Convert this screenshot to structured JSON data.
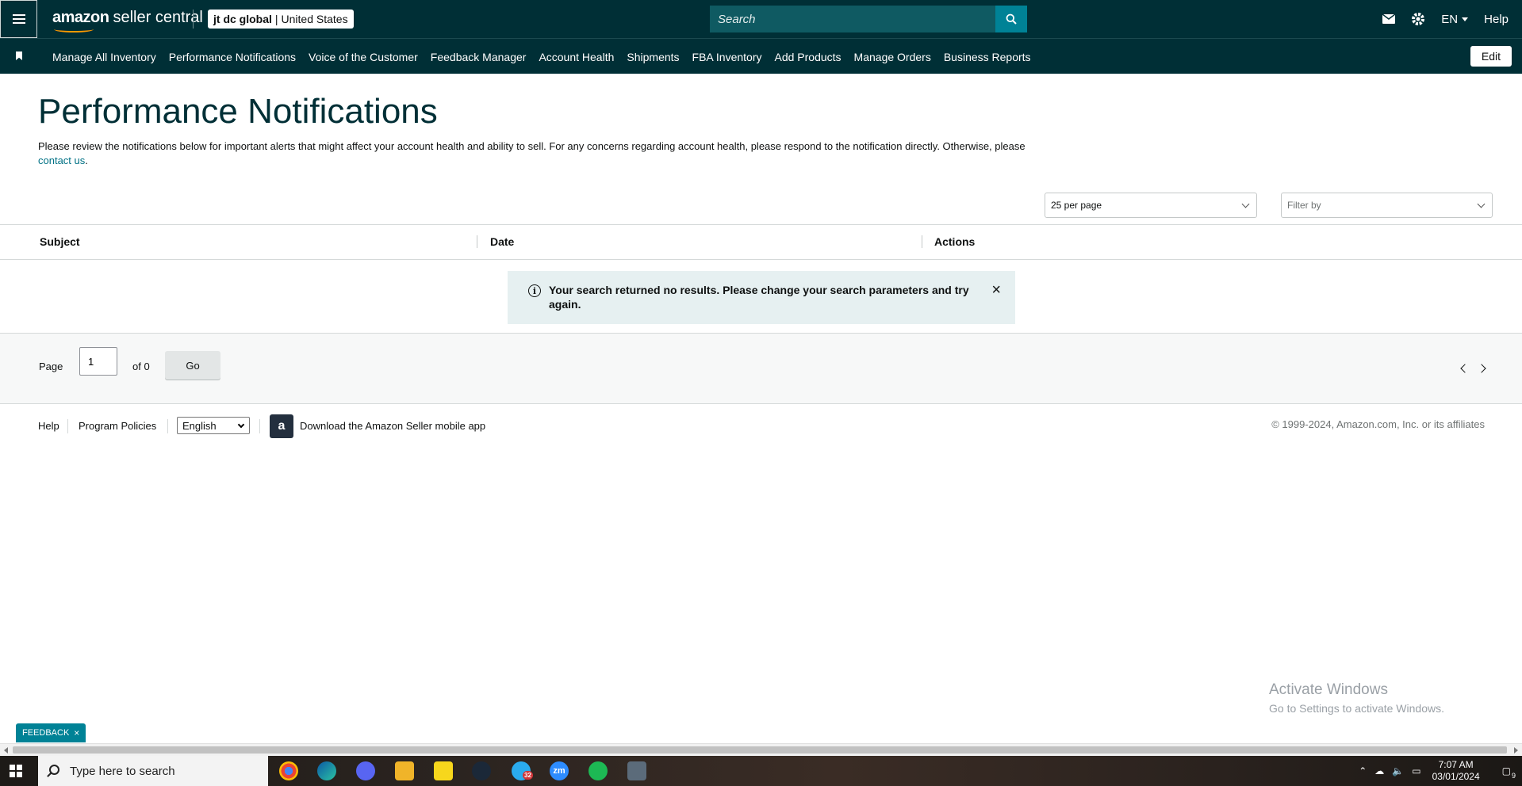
{
  "header": {
    "logo_brand": "amazon",
    "logo_product": "seller central",
    "account_name": "jt dc global",
    "account_separator": "|",
    "marketplace": "United States",
    "search_placeholder": "Search",
    "language": "EN",
    "help": "Help"
  },
  "nav": {
    "items": [
      "Manage All Inventory",
      "Performance Notifications",
      "Voice of the Customer",
      "Feedback Manager",
      "Account Health",
      "Shipments",
      "FBA Inventory",
      "Add Products",
      "Manage Orders",
      "Business Reports"
    ],
    "edit": "Edit"
  },
  "main": {
    "title": "Performance Notifications",
    "description": "Please review the notifications below for important alerts that might affect your account health and ability to sell. For any concerns regarding account health, please respond to the notification directly. Otherwise, please",
    "contact_link": "contact us",
    "period": ".",
    "per_page": "25 per page",
    "filter_placeholder": "Filter by",
    "columns": [
      "Subject",
      "Date",
      "Actions"
    ],
    "alert_icon": "i",
    "alert_text": "Your search returned no results. Please change your search parameters and try again.",
    "alert_close": "×"
  },
  "pager": {
    "page_label": "Page",
    "page_value": "1",
    "of_label": "of 0",
    "go": "Go"
  },
  "footer": {
    "help": "Help",
    "program_policies": "Program Policies",
    "language_select": "English",
    "app_icon_letter": "a",
    "download_app": "Download the Amazon Seller mobile app",
    "copyright": "© 1999-2024, Amazon.com, Inc. or its affiliates"
  },
  "overlay": {
    "activate_title": "Activate Windows",
    "activate_sub": "Go to Settings to activate Windows.",
    "feedback": "FEEDBACK",
    "feedback_close": "×"
  },
  "taskbar": {
    "search_placeholder": "Type here to search",
    "telegram_badge": "32",
    "zoom_label": "zm",
    "time": "7:07 AM",
    "date": "03/01/2024",
    "notifications_count": "9"
  },
  "colors": {
    "header_bg": "#002f36",
    "accent": "#008296",
    "link": "#007185",
    "alert_bg": "#e6f0f1"
  }
}
